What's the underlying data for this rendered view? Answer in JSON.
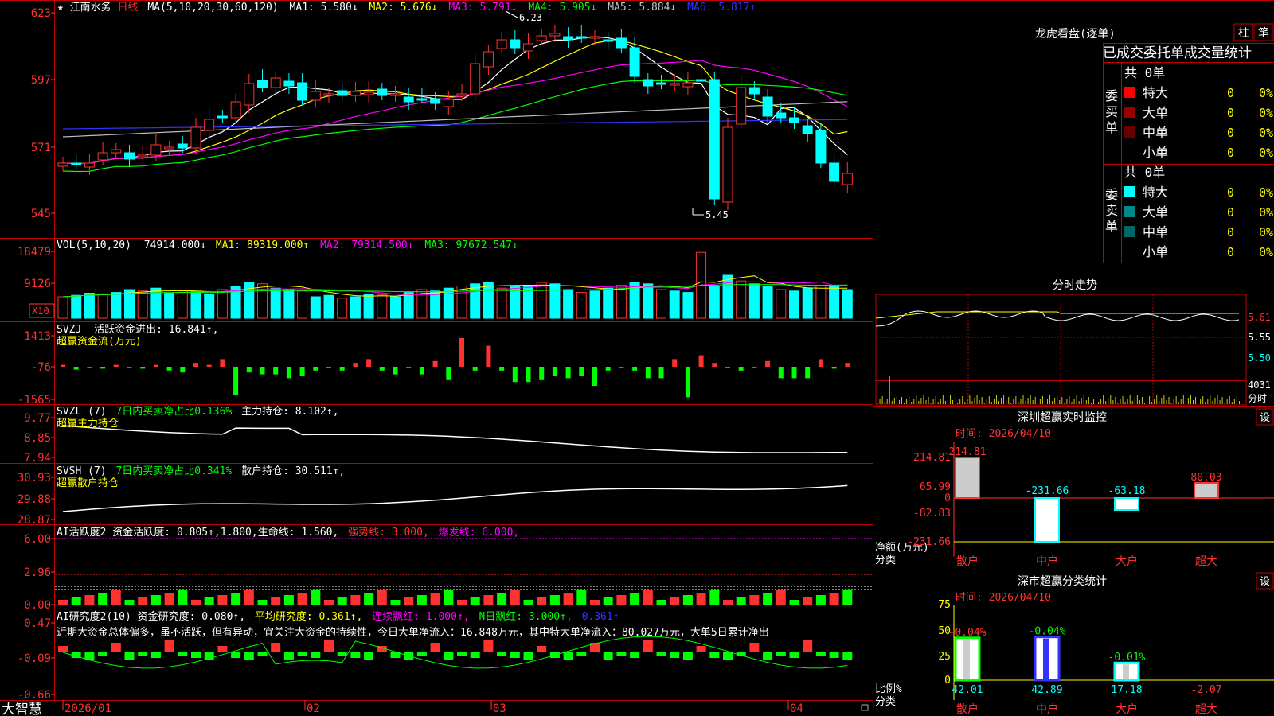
{
  "stock": {
    "star": "★",
    "name": "江南水务",
    "period": "日线"
  },
  "ma_header": {
    "label": "MA(5,10,20,30,60,120)",
    "items": [
      {
        "text": "MA1: 5.580↓",
        "color": "#ffffff"
      },
      {
        "text": "MA2: 5.676↓",
        "color": "#ffff00"
      },
      {
        "text": "MA3: 5.791↓",
        "color": "#ff00ff"
      },
      {
        "text": "MA4: 5.905↓",
        "color": "#00ff00"
      },
      {
        "text": "MA5: 5.884↓",
        "color": "#c0c0c0"
      },
      {
        "text": "MA6: 5.817↑",
        "color": "#3333ff"
      }
    ]
  },
  "price_axis": [
    "623",
    "597",
    "571",
    "545"
  ],
  "price_annot": {
    "high": "6.23",
    "low": "5.45"
  },
  "vol_header": {
    "label": "VOL(5,10,20)",
    "value": "74914.000↓",
    "ma1": "MA1: 89319.000↑",
    "ma2": "MA2: 79314.500↓",
    "ma3": "MA3: 97672.547↓"
  },
  "vol_axis": [
    "18479",
    "9126"
  ],
  "vol_unit": "X10",
  "svzj_header": {
    "label": "SVZJ",
    "title": "活跃资金进出: 16.841↑,",
    "sub": "超赢资金流(万元)"
  },
  "svzj_axis": [
    "1413",
    "-76",
    "-1565"
  ],
  "svzl_header": {
    "label": "SVZL (7)",
    "green": "7日内买卖净占比0.136%",
    "white": "主力持仓: 8.102↑,",
    "sub": "超赢主力持仓"
  },
  "svzl_axis": [
    "9.77",
    "8.85",
    "7.94"
  ],
  "svsh_header": {
    "label": "SVSH (7)",
    "green": "7日内买卖净占比0.341%",
    "white": "散户持仓: 30.511↑,",
    "sub": "超赢散户持仓"
  },
  "svsh_axis": [
    "30.93",
    "29.88",
    "28.87"
  ],
  "ai1_header": {
    "label": "AI活跃度2 资金活跃度: 0.805↑,1.800,生命线: 1.560,",
    "strong": "强势线: 3.000,",
    "burst": "爆发线: 6.000,"
  },
  "ai1_axis": [
    "6.00",
    "2.96",
    "0.00"
  ],
  "ai2_header": {
    "label": "AI研究度2(10) 资金研究度: 0.080↑,",
    "avg": "平均研究度: 0.361↑,",
    "cont": "连续飘红: 1.000↑,",
    "nday": "N日飘红: 3.000↑,",
    "last": "0.361↑"
  },
  "ai2_text": "近期大资金总体偏多，虽不活跃，但有异动，宜关注大资金的持续性，今日大单净流入：16.848万元，其中特大单净流入：80.027万元，大单5日累计净出",
  "ai2_axis": [
    "0.47",
    "-0.09",
    "-0.66"
  ],
  "date_axis": [
    "2026/01",
    "02",
    "03",
    "04"
  ],
  "brand": "大智慧",
  "right": {
    "title": "龙虎看盘(逐单)",
    "btn1": "柱",
    "btn2": "笔",
    "subtitle": "已成交委托单成交量统计",
    "buy_label": "委买单",
    "sell_label": "委卖单",
    "buy_total": "共 0单",
    "sell_total": "共 0单",
    "buy_rows": [
      {
        "name": "特大",
        "v": "0",
        "p": "0%",
        "c": "#ff0000"
      },
      {
        "name": "大单",
        "v": "0",
        "p": "0%",
        "c": "#990000"
      },
      {
        "name": "中单",
        "v": "0",
        "p": "0%",
        "c": "#660000"
      },
      {
        "name": "小单",
        "v": "0",
        "p": "0%",
        "c": ""
      }
    ],
    "sell_rows": [
      {
        "name": "特大",
        "v": "0",
        "p": "0%",
        "c": "#00ffff"
      },
      {
        "name": "大单",
        "v": "0",
        "p": "0%",
        "c": "#008888"
      },
      {
        "name": "中单",
        "v": "0",
        "p": "0%",
        "c": "#006666"
      },
      {
        "name": "小单",
        "v": "0",
        "p": "0%",
        "c": ""
      }
    ],
    "intraday_title": "分时走势",
    "intraday_axis": [
      "5.61",
      "5.55",
      "5.50"
    ],
    "intraday_vol": "4031",
    "intraday_vol_label": "分时",
    "sz_title": "深圳超赢实时监控",
    "sz_btn": "设",
    "sz_date": "时间: 2026/04/10",
    "sz_axis": [
      "214.81",
      "65.99",
      "0",
      "-82.83",
      "-231.66"
    ],
    "sz_axis_label": "净额(万元)",
    "sz_cat_label": "分类",
    "sz_values": [
      {
        "cat": "散户",
        "val": "214.81",
        "num": 214.81
      },
      {
        "cat": "中户",
        "val": "-231.66",
        "num": -231.66
      },
      {
        "cat": "大户",
        "val": "-63.18",
        "num": -63.18
      },
      {
        "cat": "超大",
        "val": "80.03",
        "num": 80.03
      }
    ],
    "cls_title": "深市超赢分类统计",
    "cls_btn": "设",
    "cls_date": "时间: 2026/04/10",
    "cls_axis": [
      "75",
      "50",
      "25",
      "0"
    ],
    "cls_axis_label": "比例%",
    "cls_cat_label": "分类",
    "cls_values": [
      {
        "cat": "散户",
        "top": "+0.04%",
        "bottom": "42.01",
        "num": 42.01
      },
      {
        "cat": "中户",
        "top": "-0.04%",
        "bottom": "42.89",
        "num": 42.89
      },
      {
        "cat": "大户",
        "top": "-0.01%",
        "bottom": "17.18",
        "num": 17.18
      },
      {
        "cat": "超大",
        "top": "",
        "bottom": "-2.07",
        "num": -2.07
      }
    ]
  },
  "colors": {
    "up": "#ff3232",
    "down": "#00ffff",
    "grid": "#c00000",
    "axis": "#ff3232",
    "label": "#ff3232"
  }
}
